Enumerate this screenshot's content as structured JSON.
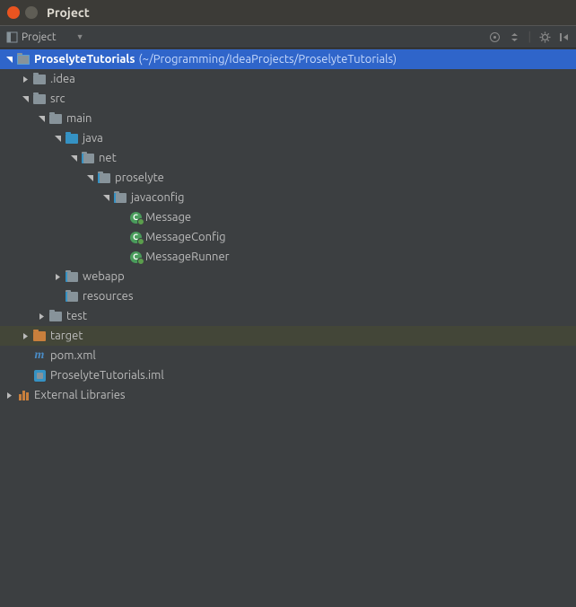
{
  "window": {
    "title": "Project"
  },
  "toolbar": {
    "viewLabel": "Project"
  },
  "tree": {
    "root": {
      "name": "ProselyteTutorials",
      "path": "(~/Programming/IdeaProjects/ProselyteTutorials)"
    },
    "idea": ".idea",
    "src": "src",
    "main": "main",
    "java": "java",
    "net": "net",
    "proselyte": "proselyte",
    "javaconfig": "javaconfig",
    "classes": {
      "message": "Message",
      "messageConfig": "MessageConfig",
      "messageRunner": "MessageRunner"
    },
    "webapp": "webapp",
    "resources": "resources",
    "test": "test",
    "target": "target",
    "pom": "pom.xml",
    "iml": "ProselyteTutorials.iml",
    "external": "External Libraries"
  }
}
